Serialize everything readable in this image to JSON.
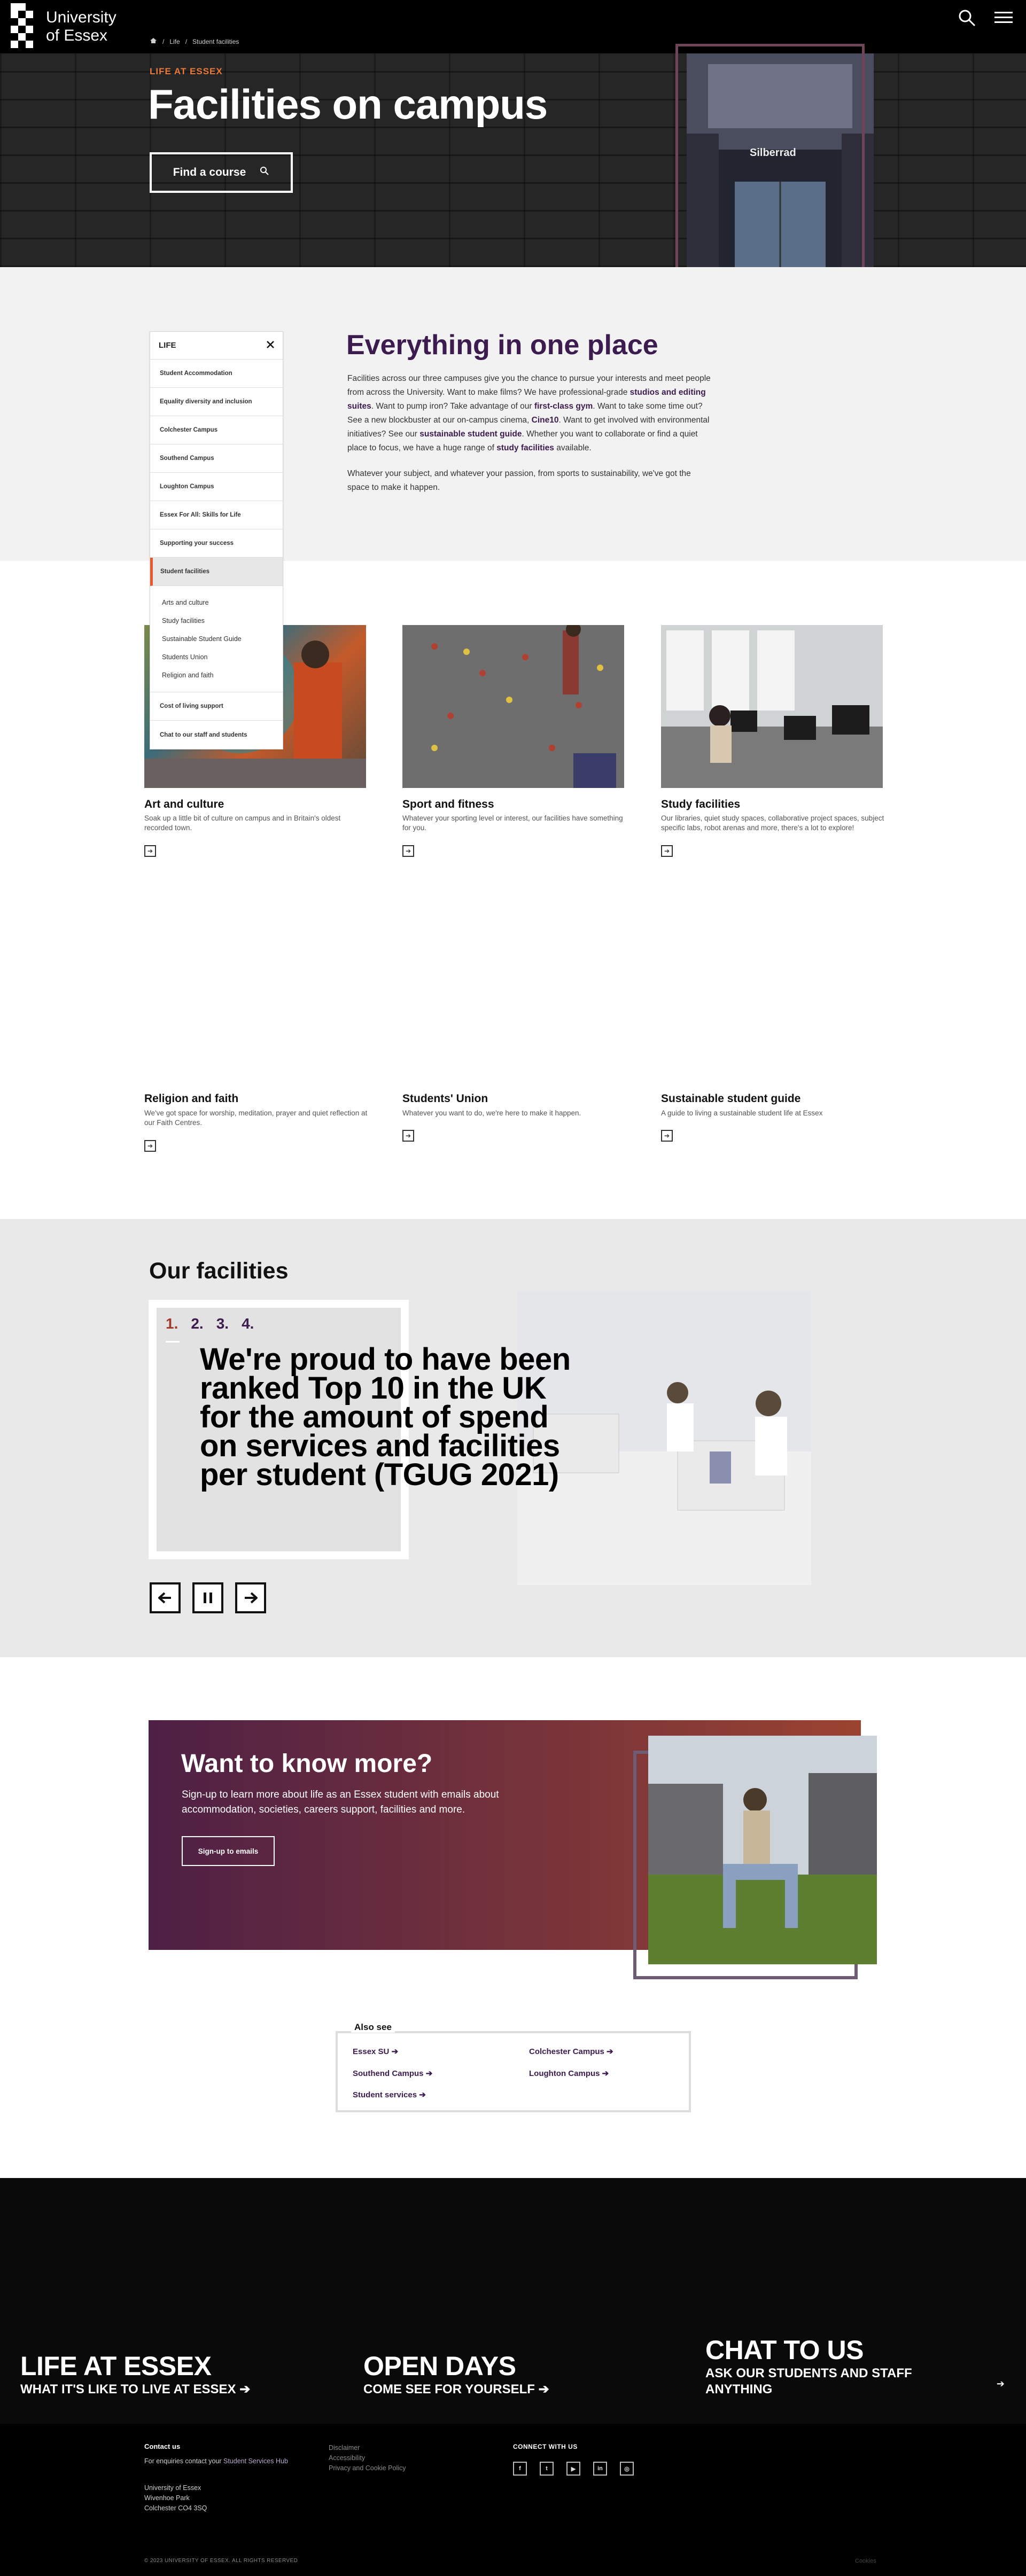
{
  "header": {
    "logo_line1": "University",
    "logo_line2": "of Essex",
    "search_icon": "search-icon",
    "menu_icon": "menu-icon"
  },
  "hero": {
    "breadcrumb": {
      "home_icon": "home-icon",
      "items": [
        "Life",
        "Student facilities"
      ]
    },
    "kicker": "LIFE AT ESSEX",
    "title": "Facilities on campus",
    "find_course": "Find a course",
    "photo_sign": "Silberrad"
  },
  "intro": {
    "heading": "Everything in one place",
    "p1": [
      "Facilities across our three campuses give you the chance to pursue your interests and meet people from across the University. Want to make films? We have professional-grade ",
      "studios and editing suites",
      ". Want to pump iron? Take advantage of our ",
      "first-class gym",
      ". Want to take some time out? See a new blockbuster at our on-campus cinema, ",
      "Cine10",
      ". Want to get involved with environmental initiatives? See our ",
      "sustainable student guide",
      ". Whether you want to collaborate or find a quiet place to focus, we have a huge range of ",
      "study facilities",
      " available."
    ],
    "p2": "Whatever your subject, and whatever your passion, from sports to sustainability, we've got the space to make it happen."
  },
  "sidenav": {
    "title": "LIFE",
    "close_icon": "close-icon",
    "items": [
      "Student Accommodation",
      "Equality diversity and inclusion",
      "Colchester Campus",
      "Southend Campus",
      "Loughton Campus",
      "Essex For All: Skills for Life",
      "Supporting your success"
    ],
    "active": "Student facilities",
    "sub_items": [
      "Arts and culture",
      "Study facilities",
      "Sustainable Student Guide",
      "Students Union",
      "Religion and faith"
    ],
    "after": [
      "Cost of living support",
      "Chat to our staff and students"
    ]
  },
  "cards": [
    {
      "title": "Art and culture",
      "desc": "Soak up a little bit of culture on campus and in Britain's oldest recorded town."
    },
    {
      "title": "Sport and fitness",
      "desc": "Whatever your sporting level or interest, our facilities have something for you."
    },
    {
      "title": "Study facilities",
      "desc": "Our libraries, quiet study spaces, collaborative project spaces, subject specific labs, robot arenas and more, there's a lot to explore!"
    },
    {
      "title": "Religion and faith",
      "desc": "We've got space for worship, meditation, prayer and quiet reflection at our Faith Centres."
    },
    {
      "title": "Students' Union",
      "desc": "Whatever you want to do, we're here to make it happen."
    },
    {
      "title": "Sustainable student guide",
      "desc": "A guide to living a sustainable student life at Essex"
    }
  ],
  "facilities": {
    "heading": "Our facilities",
    "numbers": [
      "1.",
      "2.",
      "3.",
      "4."
    ],
    "quote": "We're proud to have been ranked Top 10 in the UK for the amount of spend on services and facilities per student (TGUG 2021)",
    "controls": [
      "prev-icon",
      "pause-icon",
      "next-icon"
    ]
  },
  "want": {
    "heading": "Want to know more?",
    "text": "Sign-up to learn more about life as an Essex student with emails about accommodation, societies, careers support, facilities and more.",
    "button": "Sign-up to emails"
  },
  "also_see": {
    "heading": "Also see",
    "links": [
      "Essex SU",
      "Colchester Campus",
      "Southend Campus",
      "Loughton Campus",
      "Student services"
    ]
  },
  "big_footer": [
    {
      "title": "LIFE AT ESSEX",
      "sub": "WHAT IT'S LIKE TO LIVE AT ESSEX"
    },
    {
      "title": "OPEN DAYS",
      "sub": "COME SEE FOR YOURSELF"
    },
    {
      "title": "CHAT TO US",
      "sub": "ASK OUR STUDENTS AND STAFF ANYTHING"
    }
  ],
  "footer": {
    "contact_heading": "Contact us",
    "enquiries_prefix": "For enquiries contact your ",
    "enquiries_link": "Student Services Hub",
    "address": [
      "University of Essex",
      "Wivenhoe Park",
      "Colchester CO4 3SQ"
    ],
    "links": [
      "Disclaimer",
      "Accessibility",
      "Privacy and Cookie Policy"
    ],
    "connect_heading": "CONNECT WITH US",
    "social": [
      "facebook-icon",
      "twitter-icon",
      "youtube-icon",
      "linkedin-icon",
      "instagram-icon"
    ],
    "copyright": "© 2023 UNIVERSITY OF ESSEX. ALL RIGHTS RESERVED",
    "cookies": "Cookies"
  },
  "colors": {
    "purple": "#3c1b4f",
    "orange": "#ea7a3a",
    "black": "#000000"
  }
}
